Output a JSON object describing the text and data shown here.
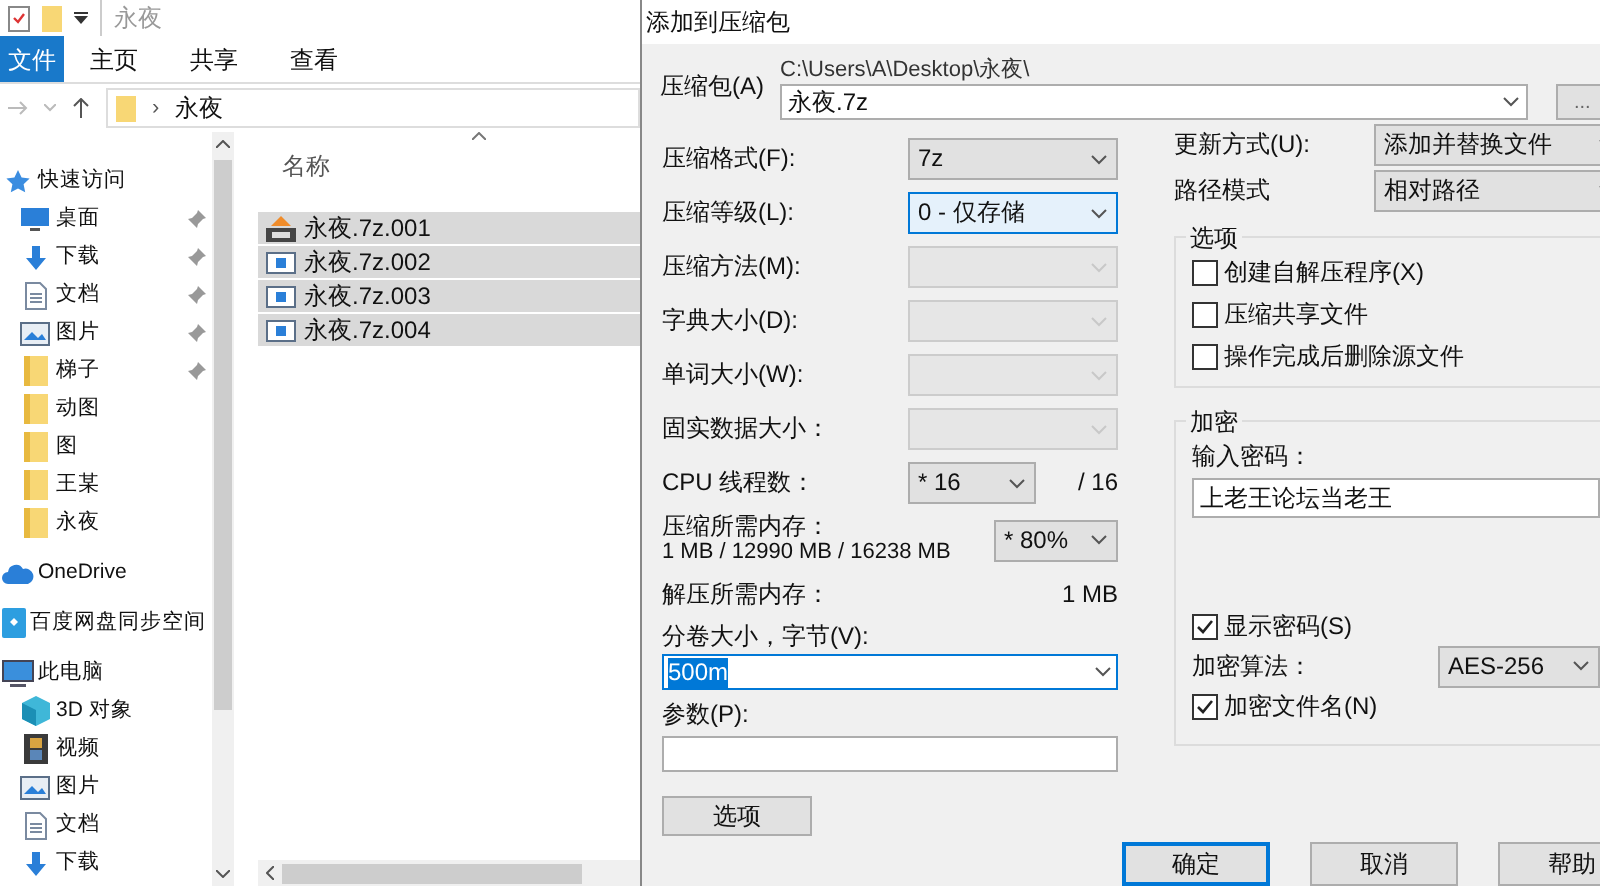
{
  "explorer": {
    "title": "永夜",
    "ribbon_tabs": [
      {
        "label": "文件",
        "selected": true
      },
      {
        "label": "主页",
        "selected": false
      },
      {
        "label": "共享",
        "selected": false
      },
      {
        "label": "查看",
        "selected": false
      }
    ],
    "address_separator": "›",
    "address": "永夜",
    "nav": [
      {
        "label": "快速访问",
        "kind": "star",
        "pinned": false,
        "children": [
          {
            "label": "桌面",
            "kind": "desktop",
            "pinned": true
          },
          {
            "label": "下载",
            "kind": "download",
            "pinned": true
          },
          {
            "label": "文档",
            "kind": "document",
            "pinned": true
          },
          {
            "label": "图片",
            "kind": "picture",
            "pinned": true
          },
          {
            "label": "梯子",
            "kind": "folder",
            "pinned": true
          },
          {
            "label": "动图",
            "kind": "folder",
            "pinned": false
          },
          {
            "label": "图",
            "kind": "folder",
            "pinned": false
          },
          {
            "label": "王某",
            "kind": "folder",
            "pinned": false
          },
          {
            "label": "永夜",
            "kind": "folder",
            "pinned": false
          }
        ]
      },
      {
        "label": "OneDrive",
        "kind": "cloud",
        "pinned": false
      },
      {
        "label": "百度网盘同步空间",
        "kind": "sync",
        "pinned": false
      },
      {
        "label": "此电脑",
        "kind": "pc",
        "pinned": false,
        "children": [
          {
            "label": "3D 对象",
            "kind": "cube",
            "pinned": false
          },
          {
            "label": "视频",
            "kind": "video",
            "pinned": false
          },
          {
            "label": "图片",
            "kind": "picture",
            "pinned": false
          },
          {
            "label": "文档",
            "kind": "document",
            "pinned": false
          },
          {
            "label": "下载",
            "kind": "download",
            "pinned": false
          }
        ]
      }
    ],
    "column": "名称",
    "files": [
      {
        "name": "永夜.7z.001",
        "kind": "archive",
        "selected": true
      },
      {
        "name": "永夜.7z.002",
        "kind": "file",
        "selected": true
      },
      {
        "name": "永夜.7z.003",
        "kind": "file",
        "selected": true
      },
      {
        "name": "永夜.7z.004",
        "kind": "file",
        "selected": true
      }
    ]
  },
  "dialog": {
    "title": "添加到压缩包",
    "archive_label": "压缩包(A)",
    "archive_path": "C:\\Users\\A\\Desktop\\永夜\\",
    "archive_name": "永夜.7z",
    "browse": "...",
    "left_rows": [
      {
        "label": "压缩格式(F):",
        "value": "7z",
        "disabled": false,
        "focused": false
      },
      {
        "label": "压缩等级(L):",
        "value": "0 - 仅存储",
        "disabled": false,
        "focused": true
      },
      {
        "label": "压缩方法(M):",
        "disabled": true,
        "focused": false
      },
      {
        "label": "字典大小(D):",
        "disabled": true,
        "focused": false
      },
      {
        "label": "单词大小(W):",
        "disabled": true,
        "focused": false
      },
      {
        "label": "固实数据大小：",
        "disabled": true,
        "focused": false
      }
    ],
    "cpu": {
      "label": "CPU 线程数：",
      "value": "* 16",
      "max": "/ 16"
    },
    "memory": {
      "label": "压缩所需内存：",
      "detail": "1 MB / 12990 MB / 16238 MB",
      "value": "* 80%"
    },
    "decompress": {
      "label": "解压所需内存：",
      "value": "1 MB"
    },
    "volume": {
      "label": "分卷大小，字节(V):",
      "value": "500m"
    },
    "params": {
      "label": "参数(P):"
    },
    "options_button": "选项",
    "update": {
      "label": "更新方式(U):",
      "value": "添加并替换文件"
    },
    "path_mode": {
      "label": "路径模式",
      "value": "相对路径"
    },
    "options": {
      "title": "选项",
      "items": [
        {
          "label": "创建自解压程序(X)",
          "checked": false
        },
        {
          "label": "压缩共享文件",
          "checked": false
        },
        {
          "label": "操作完成后删除源文件",
          "checked": false
        }
      ]
    },
    "encryption": {
      "title": "加密",
      "password_label": "输入密码：",
      "password": "上老王论坛当老王",
      "show_password": {
        "label": "显示密码(S)",
        "checked": true
      },
      "method_label": "加密算法：",
      "method": "AES-256",
      "encrypt_names": {
        "label": "加密文件名(N)",
        "checked": true
      }
    },
    "buttons": [
      {
        "label": "确定",
        "default": true
      },
      {
        "label": "取消",
        "default": false
      },
      {
        "label": "帮助",
        "default": false
      }
    ]
  }
}
